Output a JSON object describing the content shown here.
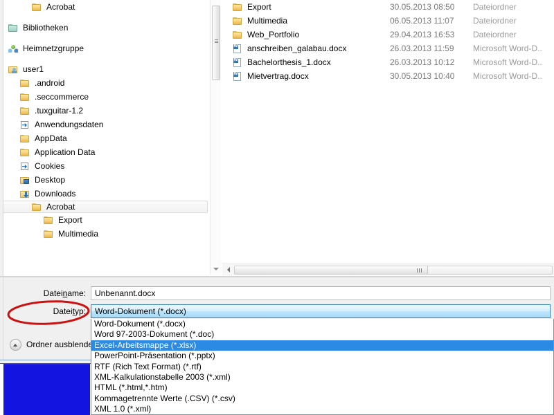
{
  "browser": {
    "nav_tree": {
      "items": [
        {
          "label": "Acrobat",
          "icon": "folder-icon",
          "indent": 2,
          "gap": false,
          "selected": false
        },
        {
          "label": "Bibliotheken",
          "icon": "library-icon",
          "indent": 0,
          "gap": true,
          "selected": false
        },
        {
          "label": "Heimnetzgruppe",
          "icon": "network-icon",
          "indent": 0,
          "gap": true,
          "selected": false
        },
        {
          "label": "user1",
          "icon": "user-folder-icon",
          "indent": 0,
          "gap": true,
          "selected": false
        },
        {
          "label": ".android",
          "icon": "folder-icon",
          "indent": 1,
          "gap": false,
          "selected": false
        },
        {
          "label": ".seccommerce",
          "icon": "folder-icon",
          "indent": 1,
          "gap": false,
          "selected": false
        },
        {
          "label": ".tuxguitar-1.2",
          "icon": "folder-icon",
          "indent": 1,
          "gap": false,
          "selected": false
        },
        {
          "label": "Anwendungsdaten",
          "icon": "shortcut-icon",
          "indent": 1,
          "gap": false,
          "selected": false
        },
        {
          "label": "AppData",
          "icon": "folder-icon",
          "indent": 1,
          "gap": false,
          "selected": false
        },
        {
          "label": "Application Data",
          "icon": "folder-icon",
          "indent": 1,
          "gap": false,
          "selected": false
        },
        {
          "label": "Cookies",
          "icon": "shortcut-icon",
          "indent": 1,
          "gap": false,
          "selected": false
        },
        {
          "label": "Desktop",
          "icon": "desktop-icon",
          "indent": 1,
          "gap": false,
          "selected": false
        },
        {
          "label": "Downloads",
          "icon": "downloads-icon",
          "indent": 1,
          "gap": false,
          "selected": false
        },
        {
          "label": "Acrobat",
          "icon": "folder-icon",
          "indent": 2,
          "gap": false,
          "selected": true
        },
        {
          "label": "Export",
          "icon": "folder-icon",
          "indent": 3,
          "gap": false,
          "selected": false
        },
        {
          "label": "Multimedia",
          "icon": "folder-icon",
          "indent": 3,
          "gap": false,
          "selected": false
        }
      ]
    },
    "file_list": {
      "rows": [
        {
          "name": "Export",
          "icon": "folder-icon",
          "date": "30.05.2013 08:50",
          "type": "Dateiordner"
        },
        {
          "name": "Multimedia",
          "icon": "folder-icon",
          "date": "06.05.2013 11:07",
          "type": "Dateiordner"
        },
        {
          "name": "Web_Portfolio",
          "icon": "folder-icon",
          "date": "29.04.2013 16:53",
          "type": "Dateiordner"
        },
        {
          "name": "anschreiben_galabau.docx",
          "icon": "word-doc-icon",
          "date": "26.03.2013 11:59",
          "type": "Microsoft Word-D.."
        },
        {
          "name": "Bachelorthesis_1.docx",
          "icon": "word-doc-icon",
          "date": "26.03.2013 10:12",
          "type": "Microsoft Word-D.."
        },
        {
          "name": "Mietvertrag.docx",
          "icon": "word-doc-icon",
          "date": "30.05.2013 10:40",
          "type": "Microsoft Word-D.."
        }
      ]
    }
  },
  "dialog": {
    "filename_label": "Dateiname:",
    "filename_value": "Unbenannt.docx",
    "filetype_label": "Dateityp:",
    "filetype_value": "Word-Dokument (*.docx)",
    "hide_folders_label": "Ordner ausblenden",
    "filetype_options": [
      {
        "label": "Word-Dokument (*.docx)",
        "highlighted": false
      },
      {
        "label": "Word 97-2003-Dokument (*.doc)",
        "highlighted": false
      },
      {
        "label": "Excel-Arbeitsmappe (*.xlsx)",
        "highlighted": true
      },
      {
        "label": "PowerPoint-Präsentation (*.pptx)",
        "highlighted": false
      },
      {
        "label": "RTF (Rich Text Format) (*.rtf)",
        "highlighted": false
      },
      {
        "label": "XML-Kalkulationstabelle 2003 (*.xml)",
        "highlighted": false
      },
      {
        "label": "HTML (*.html,*.htm)",
        "highlighted": false
      },
      {
        "label": "Kommagetrennte Werte (.CSV) (*.csv)",
        "highlighted": false
      },
      {
        "label": "XML 1.0 (*.xml)",
        "highlighted": false
      }
    ]
  },
  "annotation": {
    "shape": "ellipse",
    "color": "#cc1111",
    "targets": "Dateityp:"
  },
  "colors": {
    "selection_blue": "#2a8ae4",
    "combo_border": "#3c7fb1",
    "annotation_red": "#cc1111",
    "desktop_blue": "#1414e0",
    "panel_gray": "#f0f0f0"
  }
}
